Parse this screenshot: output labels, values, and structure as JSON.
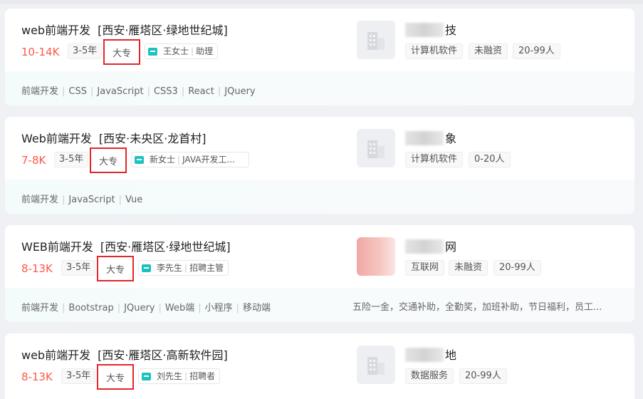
{
  "cards": [
    {
      "title": "web前端开发",
      "location": "[西安·雁塔区·绿地世纪城]",
      "salary": "10-14K",
      "experience": "3-5年",
      "education": "大专",
      "recruiter_name": "王女士",
      "recruiter_role": "助理",
      "company_name_suffix": "技",
      "company_tags": [
        "计算机软件",
        "未融资",
        "20-99人"
      ],
      "skills": [
        "前端开发",
        "CSS",
        "JavaScript",
        "CSS3",
        "React",
        "JQuery"
      ],
      "welfare": ""
    },
    {
      "title": "Web前端开发",
      "location": "[西安·未央区·龙首村]",
      "salary": "7-8K",
      "experience": "3-5年",
      "education": "大专",
      "recruiter_name": "新女士",
      "recruiter_role": "JAVA开发工...",
      "company_name_suffix": "象",
      "company_tags": [
        "计算机软件",
        "0-20人"
      ],
      "skills": [
        "前端开发",
        "JavaScript",
        "Vue"
      ],
      "welfare": ""
    },
    {
      "title": "WEB前端开发",
      "location": "[西安·雁塔区·绿地世纪城]",
      "salary": "8-13K",
      "experience": "3-5年",
      "education": "大专",
      "recruiter_name": "李先生",
      "recruiter_role": "招聘主管",
      "company_name_suffix": "网",
      "company_tags": [
        "互联网",
        "未融资",
        "20-99人"
      ],
      "skills": [
        "前端开发",
        "Bootstrap",
        "JQuery",
        "Web端",
        "小程序",
        "移动端"
      ],
      "welfare": "五险一金，交通补助，全勤奖，加班补助，节日福利，员工..."
    },
    {
      "title": "web前端开发",
      "location": "[西安·雁塔区·高新软件园]",
      "salary": "8-13K",
      "experience": "3-5年",
      "education": "大专",
      "recruiter_name": "刘先生",
      "recruiter_role": "招聘者",
      "company_name_suffix": "地",
      "company_tags": [
        "数据服务",
        "20-99人"
      ],
      "skills": [],
      "welfare": ""
    }
  ],
  "colors": {
    "salary": "#fe574a",
    "highlight_border": "#e3262a",
    "chat_icon": "#1cc2c0"
  },
  "icons": [
    "chat-icon",
    "building-icon"
  ]
}
